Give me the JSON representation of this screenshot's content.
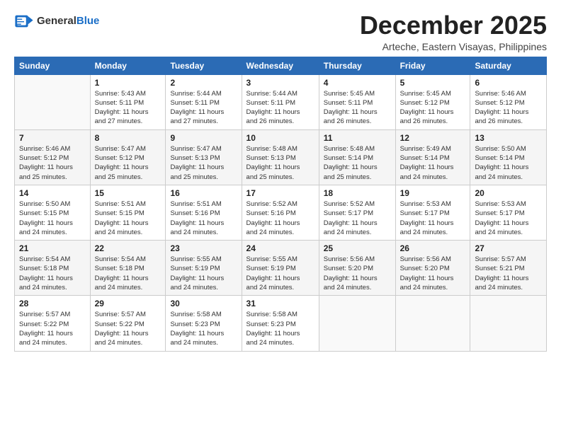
{
  "header": {
    "logo_line1": "General",
    "logo_line2": "Blue",
    "month": "December 2025",
    "location": "Arteche, Eastern Visayas, Philippines"
  },
  "weekdays": [
    "Sunday",
    "Monday",
    "Tuesday",
    "Wednesday",
    "Thursday",
    "Friday",
    "Saturday"
  ],
  "weeks": [
    [
      {
        "day": "",
        "info": ""
      },
      {
        "day": "1",
        "info": "Sunrise: 5:43 AM\nSunset: 5:11 PM\nDaylight: 11 hours\nand 27 minutes."
      },
      {
        "day": "2",
        "info": "Sunrise: 5:44 AM\nSunset: 5:11 PM\nDaylight: 11 hours\nand 27 minutes."
      },
      {
        "day": "3",
        "info": "Sunrise: 5:44 AM\nSunset: 5:11 PM\nDaylight: 11 hours\nand 26 minutes."
      },
      {
        "day": "4",
        "info": "Sunrise: 5:45 AM\nSunset: 5:11 PM\nDaylight: 11 hours\nand 26 minutes."
      },
      {
        "day": "5",
        "info": "Sunrise: 5:45 AM\nSunset: 5:12 PM\nDaylight: 11 hours\nand 26 minutes."
      },
      {
        "day": "6",
        "info": "Sunrise: 5:46 AM\nSunset: 5:12 PM\nDaylight: 11 hours\nand 26 minutes."
      }
    ],
    [
      {
        "day": "7",
        "info": "Sunrise: 5:46 AM\nSunset: 5:12 PM\nDaylight: 11 hours\nand 25 minutes."
      },
      {
        "day": "8",
        "info": "Sunrise: 5:47 AM\nSunset: 5:12 PM\nDaylight: 11 hours\nand 25 minutes."
      },
      {
        "day": "9",
        "info": "Sunrise: 5:47 AM\nSunset: 5:13 PM\nDaylight: 11 hours\nand 25 minutes."
      },
      {
        "day": "10",
        "info": "Sunrise: 5:48 AM\nSunset: 5:13 PM\nDaylight: 11 hours\nand 25 minutes."
      },
      {
        "day": "11",
        "info": "Sunrise: 5:48 AM\nSunset: 5:14 PM\nDaylight: 11 hours\nand 25 minutes."
      },
      {
        "day": "12",
        "info": "Sunrise: 5:49 AM\nSunset: 5:14 PM\nDaylight: 11 hours\nand 24 minutes."
      },
      {
        "day": "13",
        "info": "Sunrise: 5:50 AM\nSunset: 5:14 PM\nDaylight: 11 hours\nand 24 minutes."
      }
    ],
    [
      {
        "day": "14",
        "info": "Sunrise: 5:50 AM\nSunset: 5:15 PM\nDaylight: 11 hours\nand 24 minutes."
      },
      {
        "day": "15",
        "info": "Sunrise: 5:51 AM\nSunset: 5:15 PM\nDaylight: 11 hours\nand 24 minutes."
      },
      {
        "day": "16",
        "info": "Sunrise: 5:51 AM\nSunset: 5:16 PM\nDaylight: 11 hours\nand 24 minutes."
      },
      {
        "day": "17",
        "info": "Sunrise: 5:52 AM\nSunset: 5:16 PM\nDaylight: 11 hours\nand 24 minutes."
      },
      {
        "day": "18",
        "info": "Sunrise: 5:52 AM\nSunset: 5:17 PM\nDaylight: 11 hours\nand 24 minutes."
      },
      {
        "day": "19",
        "info": "Sunrise: 5:53 AM\nSunset: 5:17 PM\nDaylight: 11 hours\nand 24 minutes."
      },
      {
        "day": "20",
        "info": "Sunrise: 5:53 AM\nSunset: 5:17 PM\nDaylight: 11 hours\nand 24 minutes."
      }
    ],
    [
      {
        "day": "21",
        "info": "Sunrise: 5:54 AM\nSunset: 5:18 PM\nDaylight: 11 hours\nand 24 minutes."
      },
      {
        "day": "22",
        "info": "Sunrise: 5:54 AM\nSunset: 5:18 PM\nDaylight: 11 hours\nand 24 minutes."
      },
      {
        "day": "23",
        "info": "Sunrise: 5:55 AM\nSunset: 5:19 PM\nDaylight: 11 hours\nand 24 minutes."
      },
      {
        "day": "24",
        "info": "Sunrise: 5:55 AM\nSunset: 5:19 PM\nDaylight: 11 hours\nand 24 minutes."
      },
      {
        "day": "25",
        "info": "Sunrise: 5:56 AM\nSunset: 5:20 PM\nDaylight: 11 hours\nand 24 minutes."
      },
      {
        "day": "26",
        "info": "Sunrise: 5:56 AM\nSunset: 5:20 PM\nDaylight: 11 hours\nand 24 minutes."
      },
      {
        "day": "27",
        "info": "Sunrise: 5:57 AM\nSunset: 5:21 PM\nDaylight: 11 hours\nand 24 minutes."
      }
    ],
    [
      {
        "day": "28",
        "info": "Sunrise: 5:57 AM\nSunset: 5:22 PM\nDaylight: 11 hours\nand 24 minutes."
      },
      {
        "day": "29",
        "info": "Sunrise: 5:57 AM\nSunset: 5:22 PM\nDaylight: 11 hours\nand 24 minutes."
      },
      {
        "day": "30",
        "info": "Sunrise: 5:58 AM\nSunset: 5:23 PM\nDaylight: 11 hours\nand 24 minutes."
      },
      {
        "day": "31",
        "info": "Sunrise: 5:58 AM\nSunset: 5:23 PM\nDaylight: 11 hours\nand 24 minutes."
      },
      {
        "day": "",
        "info": ""
      },
      {
        "day": "",
        "info": ""
      },
      {
        "day": "",
        "info": ""
      }
    ]
  ]
}
